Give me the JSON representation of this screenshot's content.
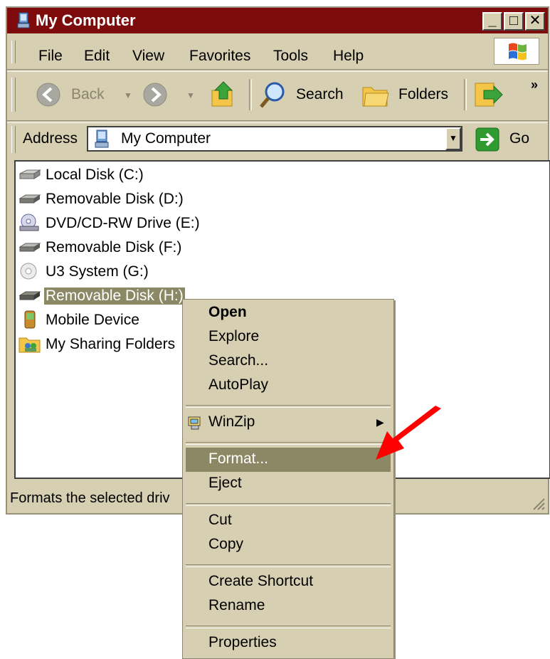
{
  "window": {
    "title": "My Computer",
    "minimize_glyph": "_",
    "maximize_glyph": "□",
    "close_glyph": "✕"
  },
  "menubar": {
    "items": [
      "File",
      "Edit",
      "View",
      "Favorites",
      "Tools",
      "Help"
    ]
  },
  "toolbar": {
    "back_label": "Back",
    "search_label": "Search",
    "folders_label": "Folders",
    "overflow_glyph": "»"
  },
  "address": {
    "label": "Address",
    "value": "My Computer",
    "go_label": "Go"
  },
  "drives": [
    {
      "label": "Local Disk (C:)",
      "icon": "hard-disk-icon"
    },
    {
      "label": "Removable Disk (D:)",
      "icon": "removable-disk-icon"
    },
    {
      "label": "DVD/CD-RW Drive (E:)",
      "icon": "dvd-drive-icon"
    },
    {
      "label": "Removable Disk (F:)",
      "icon": "removable-disk-icon"
    },
    {
      "label": "U3 System (G:)",
      "icon": "cd-icon"
    },
    {
      "label": "Removable Disk (H:)",
      "icon": "removable-disk-icon",
      "selected": true
    },
    {
      "label": "Mobile Device",
      "icon": "mobile-device-icon"
    },
    {
      "label": "My Sharing Folders",
      "icon": "sharing-folders-icon"
    }
  ],
  "status": {
    "text": "Formats the selected driv"
  },
  "context_menu": {
    "items": [
      {
        "label": "Open",
        "bold": true
      },
      {
        "label": "Explore"
      },
      {
        "label": "Search..."
      },
      {
        "label": "AutoPlay"
      },
      {
        "label": "WinZip",
        "submenu": true
      },
      {
        "label": "Format...",
        "highlighted": true
      },
      {
        "label": "Eject"
      },
      {
        "label": "Cut"
      },
      {
        "label": "Copy"
      },
      {
        "label": "Create Shortcut"
      },
      {
        "label": "Rename"
      },
      {
        "label": "Properties"
      }
    ]
  },
  "colors": {
    "titlebar": "#7d0b0b",
    "chrome": "#d6cfb2",
    "selection": "#8c8866",
    "annotation_arrow": "#ff0000"
  }
}
